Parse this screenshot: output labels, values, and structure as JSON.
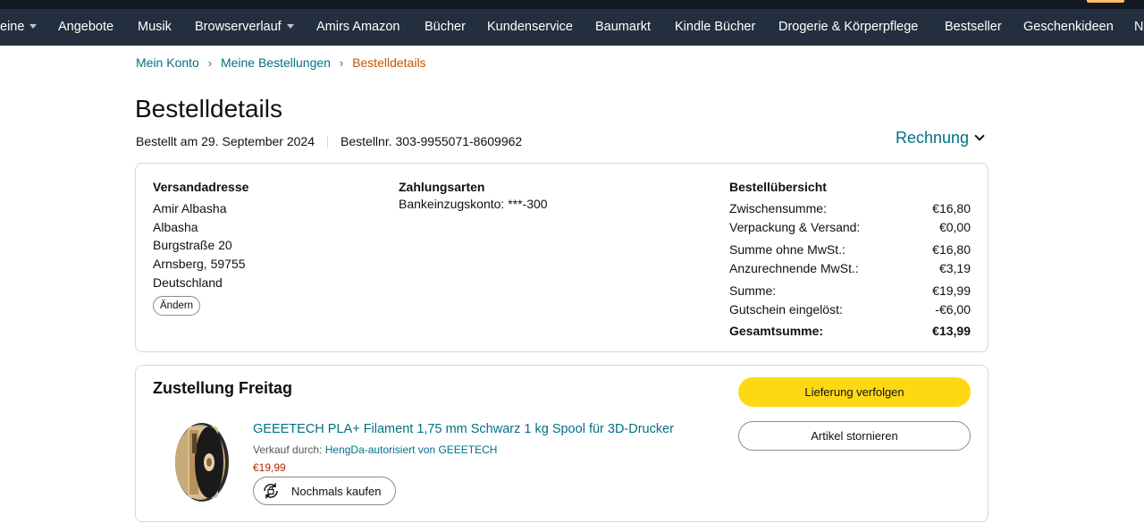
{
  "nav": {
    "items": [
      {
        "label": "eine",
        "dropdown": true
      },
      {
        "label": "Angebote",
        "dropdown": false
      },
      {
        "label": "Musik",
        "dropdown": false
      },
      {
        "label": "Browserverlauf",
        "dropdown": true
      },
      {
        "label": "Amirs Amazon",
        "dropdown": false
      },
      {
        "label": "Bücher",
        "dropdown": false
      },
      {
        "label": "Kundenservice",
        "dropdown": false
      },
      {
        "label": "Baumarkt",
        "dropdown": false
      },
      {
        "label": "Kindle Bücher",
        "dropdown": false
      },
      {
        "label": "Drogerie & Körperpflege",
        "dropdown": false
      },
      {
        "label": "Bestseller",
        "dropdown": false
      },
      {
        "label": "Geschenkideen",
        "dropdown": false
      },
      {
        "label": "N",
        "dropdown": false
      }
    ]
  },
  "breadcrumb": {
    "items": [
      "Mein Konto",
      "Meine Bestellungen",
      "Bestelldetails"
    ],
    "separator": "›"
  },
  "page": {
    "title": "Bestelldetails",
    "ordered_date": "Bestellt am 29. September 2024",
    "order_number": "Bestellnr. 303-9955071-8609962",
    "invoice_label": "Rechnung"
  },
  "shipping": {
    "heading": "Versandadresse",
    "lines": [
      "Amir Albasha",
      "Albasha",
      "Burgstraße 20",
      "Arnsberg, 59755",
      "Deutschland"
    ],
    "change_label": "Ändern"
  },
  "payment": {
    "heading": "Zahlungsarten",
    "method": "Bankeinzugskonto: ***-300"
  },
  "summary": {
    "heading": "Bestellübersicht",
    "rows": [
      {
        "label": "Zwischensumme:",
        "value": "€16,80"
      },
      {
        "label": "Verpackung & Versand:",
        "value": "€0,00"
      },
      {
        "label": "Summe ohne MwSt.:",
        "value": "€16,80"
      },
      {
        "label": "Anzurechnende MwSt.:",
        "value": "€3,19"
      },
      {
        "label": "Summe:",
        "value": "€19,99"
      },
      {
        "label": "Gutschein eingelöst:",
        "value": "-€6,00"
      },
      {
        "label": "Gesamtsumme:",
        "value": "€13,99"
      }
    ]
  },
  "delivery": {
    "title": "Zustellung Freitag",
    "track_label": "Lieferung verfolgen",
    "cancel_label": "Artikel stornieren",
    "product": {
      "title": "GEEETECH PLA+ Filament 1,75 mm Schwarz 1 kg Spool für 3D-Drucker",
      "sold_by_prefix": "Verkauf durch:",
      "seller": "HengDa-autorisiert von GEEETECH",
      "price": "€19,99",
      "rebuy_label": "Nochmals kaufen",
      "image_icon": "filament-spool-image"
    }
  },
  "colors": {
    "nav_bg": "#232f3e",
    "top_bg": "#131921",
    "link": "#007185",
    "crumb_current": "#c45500",
    "price": "#b12704",
    "primary_button": "#ffd814"
  }
}
